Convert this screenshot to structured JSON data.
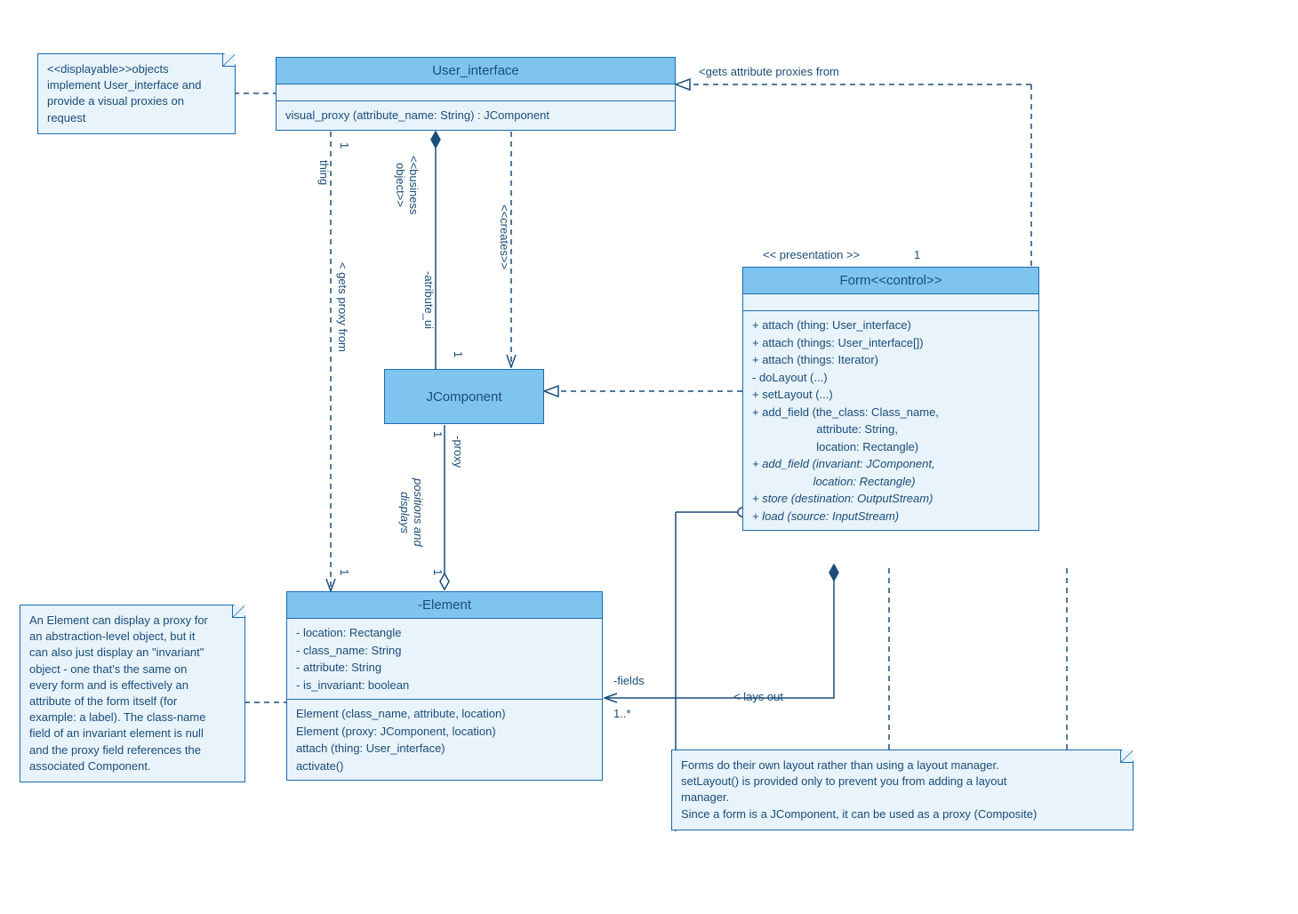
{
  "classes": {
    "user_interface": {
      "title": "User_interface",
      "method": "visual_proxy (attribute_name: String) : JComponent"
    },
    "jcomponent": {
      "title": "JComponent"
    },
    "element": {
      "title": "-Element",
      "attrs": [
        "- location: Rectangle",
        "- class_name: String",
        "- attribute: String",
        "- is_invariant: boolean"
      ],
      "ops": [
        "Element (class_name, attribute, location)",
        "Element (proxy: JComponent, location)",
        "attach (thing: User_interface)",
        "activate()"
      ]
    },
    "form": {
      "title": "Form<<control>>",
      "presentation_label": "<< presentation >>",
      "ops": [
        "+ attach (thing: User_interface)",
        "+ attach (things: User_interface[])",
        "+ attach (things: Iterator)",
        "- doLayout (...)",
        "+ setLayout (...)",
        "+ add_field (the_class: Class_name,",
        "                    attribute: String,",
        "                    location: Rectangle)"
      ],
      "ops_italic": [
        "+ add_field (invariant: JComponent,",
        "                   location: Rectangle)",
        "+ store (destination: OutputStream)",
        "+ load (source: InputStream)"
      ]
    }
  },
  "notes": {
    "displayable": "<<displayable>>objects\nimplement User_interface and\nprovide a visual proxies on\nrequest",
    "element_note": "An Element can display a proxy for\nan abstraction-level object, but it\ncan also just display an \"invariant\"\nobject - one that's the same on\nevery form and is effectively an\nattribute of the form itself (for\nexample: a label). The class-name\nfield of an invariant element is null\nand the proxy field references the\nassociated Component.",
    "form_note": "Forms do their own layout rather than using a layout manager.\nsetLayout() is provided only to prevent you from adding a layout\nmanager.\nSince a form is a JComponent, it can be used as a proxy (Composite)"
  },
  "labels": {
    "gets_attribute": "<gets attribute proxies from",
    "one_a": "1",
    "one_b": "1",
    "one_c": "1",
    "one_d": "1",
    "one_e": "1",
    "one_f": "1",
    "one_star": "1..*",
    "thing": "thing",
    "gets_proxy": "< gets proxy from",
    "business_object": "<<business\nobject>>",
    "attribute_ui": "-atribute_ui",
    "creates": "<<creates>>",
    "proxy": "-proxy",
    "positions": "positions and\ndisplays",
    "fields": "-fields",
    "lays_out": "< lays out"
  }
}
